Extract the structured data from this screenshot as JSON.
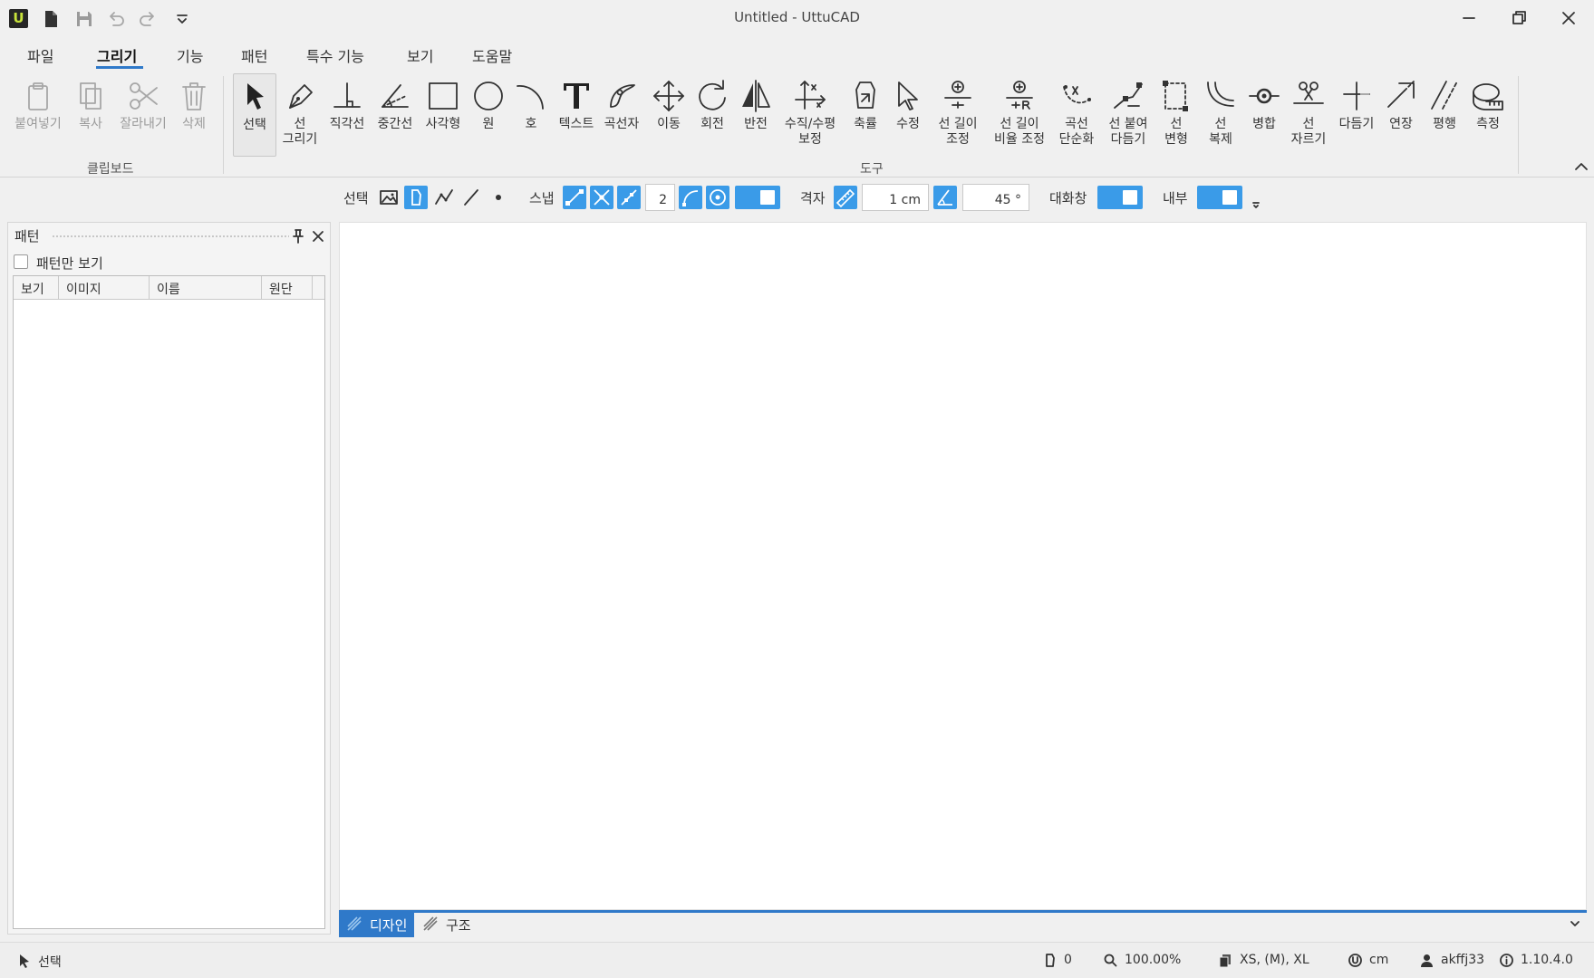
{
  "window": {
    "title": "Untitled - UttuCAD",
    "logo_letter": "U"
  },
  "quick_access": [
    "new-file-icon",
    "save-icon",
    "undo-icon",
    "redo-icon",
    "customize-dropdown-icon"
  ],
  "menu": {
    "tabs": [
      {
        "label": "파일",
        "active": false
      },
      {
        "label": "그리기",
        "active": true
      },
      {
        "label": "기능",
        "active": false
      },
      {
        "label": "패턴",
        "active": false
      },
      {
        "label": "특수 기능",
        "active": false
      },
      {
        "label": "보기",
        "active": false
      },
      {
        "label": "도움말",
        "active": false
      }
    ]
  },
  "ribbon": {
    "clipboard": {
      "group_label": "클립보드",
      "buttons": [
        {
          "label": "붙여넣기",
          "enabled": false
        },
        {
          "label": "복사",
          "enabled": false
        },
        {
          "label": "잘라내기",
          "enabled": false
        },
        {
          "label": "삭제",
          "enabled": false
        }
      ]
    },
    "tools": {
      "group_label": "도구",
      "buttons": [
        {
          "label": "선택",
          "selected": true
        },
        {
          "label": "선\n그리기"
        },
        {
          "label": "직각선"
        },
        {
          "label": "중간선"
        },
        {
          "label": "사각형"
        },
        {
          "label": "원"
        },
        {
          "label": "호"
        },
        {
          "label": "텍스트"
        },
        {
          "label": "곡선자"
        },
        {
          "label": "이동"
        },
        {
          "label": "회전"
        },
        {
          "label": "반전"
        },
        {
          "label": "수직/수평\n보정"
        },
        {
          "label": "축률"
        },
        {
          "label": "수정"
        },
        {
          "label": "선 길이\n조정"
        },
        {
          "label": "선 길이\n비율 조정"
        },
        {
          "label": "곡선\n단순화"
        },
        {
          "label": "선 붙여\n다듬기"
        },
        {
          "label": "선\n변형"
        },
        {
          "label": "선\n복제"
        },
        {
          "label": "병합"
        },
        {
          "label": "선\n자르기"
        },
        {
          "label": "다듬기"
        },
        {
          "label": "연장"
        },
        {
          "label": "평행"
        },
        {
          "label": "측정"
        }
      ]
    }
  },
  "toolbar": {
    "select_label": "선택",
    "snap_label": "스냅",
    "snap_count": "2",
    "grid_label": "격자",
    "grid_size": "1 cm",
    "angle": "45 °",
    "dialog_label": "대화창",
    "inner_label": "내부"
  },
  "panel": {
    "title": "패턴",
    "pattern_only_label": "패턴만 보기",
    "pattern_only_checked": false,
    "columns": [
      "보기",
      "이미지",
      "이름",
      "원단"
    ]
  },
  "view_tabs": [
    {
      "label": "디자인",
      "active": true
    },
    {
      "label": "구조",
      "active": false
    }
  ],
  "status": {
    "mode": "선택",
    "count": "0",
    "zoom": "100.00%",
    "sizes": "XS, (M), XL",
    "unit": "cm",
    "user": "akffj33",
    "version": "1.10.4.0"
  },
  "colors": {
    "accent": "#2f79c9",
    "toggle_on": "#3a9be8",
    "logo_bg": "#262626",
    "logo_fg": "#c7e23b"
  }
}
